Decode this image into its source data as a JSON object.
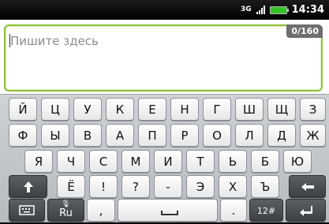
{
  "status_bar": {
    "network_type": "3G",
    "time": "14:34"
  },
  "compose": {
    "placeholder": "Пишите здесь",
    "char_counter": "0/160"
  },
  "keyboard": {
    "row1": [
      "Й",
      "Ц",
      "У",
      "К",
      "Е",
      "Н",
      "Г",
      "Ш",
      "Щ",
      "З"
    ],
    "row2": [
      "Ф",
      "Ы",
      "В",
      "А",
      "П",
      "Р",
      "О",
      "Л",
      "Д",
      "Ж"
    ],
    "row3": [
      "Я",
      "Ч",
      "С",
      "М",
      "И",
      "Т",
      "Ь",
      "Б",
      "Ю"
    ],
    "row4": [
      "Ё",
      "!",
      "?",
      "-",
      "Э",
      "Х",
      "Ъ"
    ],
    "row5": {
      "language_label": "Ru",
      "comma": ",",
      "period": ".",
      "symbols_label": "12#"
    },
    "icons": {
      "shift": "arrow-up-icon",
      "backspace": "arrow-left-icon",
      "enter": "enter-icon",
      "keyboard_settings": "keyboard-icon",
      "microphone": "microphone-icon"
    }
  }
}
